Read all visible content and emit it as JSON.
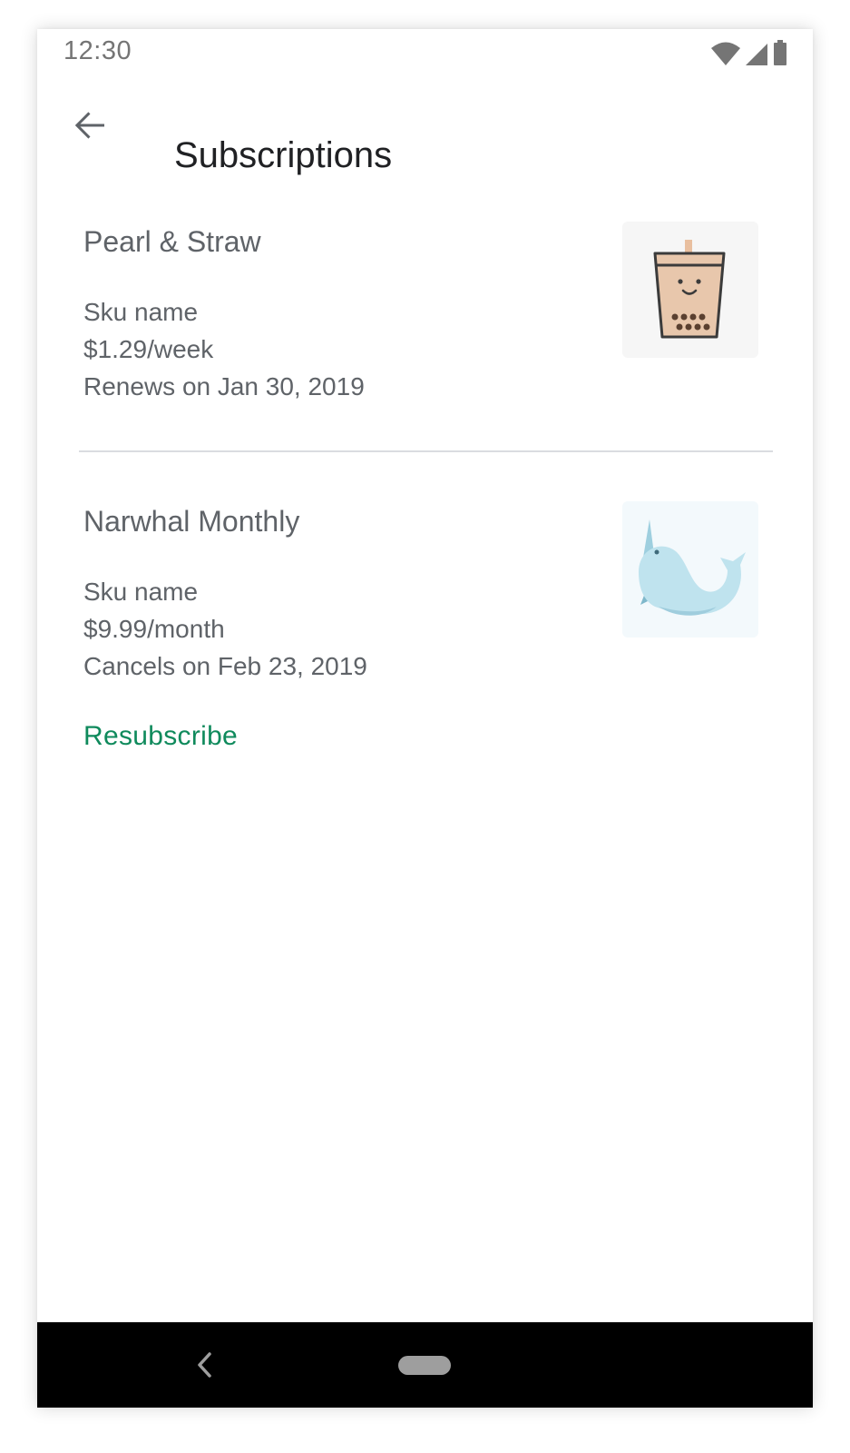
{
  "status_bar": {
    "time": "12:30",
    "icons": [
      "wifi-icon",
      "cellular-signal-icon",
      "battery-icon"
    ]
  },
  "app_bar": {
    "title": "Subscriptions",
    "back_icon": "arrow-back-icon"
  },
  "subscriptions": [
    {
      "name": "Pearl & Straw",
      "sku": "Sku name",
      "price": "$1.29/week",
      "status": "Renews on Jan 30, 2019",
      "thumbnail_icon": "bubble-tea-icon"
    },
    {
      "name": "Narwhal Monthly",
      "sku": "Sku name",
      "price": "$9.99/month",
      "status": "Cancels on Feb 23, 2019",
      "thumbnail_icon": "narwhal-icon",
      "action_label": "Resubscribe"
    }
  ],
  "nav_bar": {
    "icons": [
      "nav-back-icon",
      "nav-home-pill"
    ]
  },
  "colors": {
    "accent": "#0f8a5c",
    "text_primary": "#202124",
    "text_secondary": "#5f6368",
    "divider": "#dadce0",
    "nav_bar": "#000000"
  }
}
